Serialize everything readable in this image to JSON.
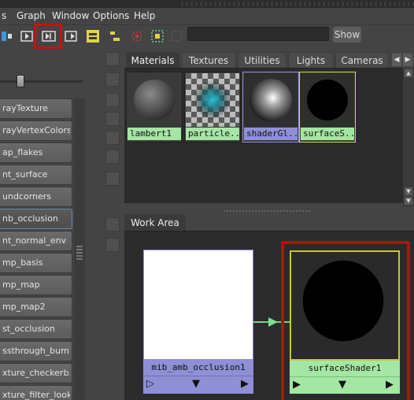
{
  "menubar": {
    "items": [
      {
        "label": "s"
      },
      {
        "label": "Graph"
      },
      {
        "label": "Window"
      },
      {
        "label": "Options"
      },
      {
        "label": "Help"
      }
    ]
  },
  "toolbar": {
    "icons": [
      "graph-upstream-icon",
      "graph-up-downstream-icon",
      "graph-downstream-icon",
      "input-output-icon",
      "clear-graph-icon",
      "rearrange-graph-icon",
      "show-hide-icon",
      "toggle-filter-icon"
    ],
    "search": {
      "value": "",
      "placeholder": ""
    },
    "show_label": "Show",
    "highlight_color": "#c01414"
  },
  "left_panel": {
    "slider_value": 0.2,
    "nodes": [
      {
        "label": "rayTexture"
      },
      {
        "label": "rayVertexColors"
      },
      {
        "label": "ap_flakes"
      },
      {
        "label": "nt_surface"
      },
      {
        "label": "undcorners"
      },
      {
        "label": "nb_occlusion",
        "selected": true
      },
      {
        "label": "nt_normal_env"
      },
      {
        "label": "mp_basis"
      },
      {
        "label": "mp_map"
      },
      {
        "label": "mp_map2"
      },
      {
        "label": "st_occlusion"
      },
      {
        "label": "ssthrough_bum..."
      },
      {
        "label": "xture_checkerb..."
      },
      {
        "label": "xture_filter_look..."
      }
    ]
  },
  "materials_panel": {
    "tabs": [
      {
        "label": "Materials",
        "active": true
      },
      {
        "label": "Textures"
      },
      {
        "label": "Utilities"
      },
      {
        "label": "Lights"
      },
      {
        "label": "Cameras"
      }
    ],
    "swatches": [
      {
        "label": "lambert1",
        "label_color": "#a4e6a4",
        "border_color": "#90c090"
      },
      {
        "label": "particle...",
        "label_color": "#a4e6a4",
        "border_color": "#5a5a5a"
      },
      {
        "label": "shaderGl...",
        "label_color": "#8f8fd6",
        "border_color": "#8f8fd6"
      },
      {
        "label": "surfaceS...",
        "label_color": "#a4e6a4",
        "border_color": "#d8d83a"
      }
    ]
  },
  "work_area": {
    "tab_label": "Work Area",
    "nodes": [
      {
        "label": "mib_amb_occlusion1",
        "color": "#8f8fd6"
      },
      {
        "label": "surfaceShader1",
        "color": "#a4e6a4"
      }
    ],
    "connection_color": "#7fdf8f",
    "highlight_color": "#b51010"
  }
}
